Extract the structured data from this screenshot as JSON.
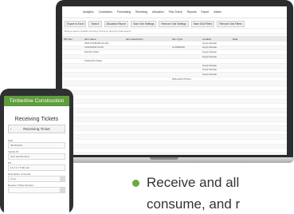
{
  "desktop": {
    "nav": [
      "Analytics",
      "Contractors",
      "Purchasing",
      "Receiving",
      "Allocation",
      "Pick Check",
      "Reports",
      "Export",
      "Admin"
    ],
    "toolbar": [
      "Export to Excel",
      "Search",
      "Allocation Report",
      "Save Grid Settings",
      "Remove Grid Settings",
      "Save Grid Filters",
      "Remove Grid Filters"
    ],
    "group_hint": "Drag a column header and drop it here to group by that column",
    "columns": [
      "Mfr Item",
      "Item Name",
      "Item Description",
      "Item Type",
      "Location",
      "Date"
    ],
    "rows": [
      [
        "",
        "SEMI-STANDARD IN-LINE",
        "",
        "",
        "Supply Mandate",
        ""
      ],
      [
        "",
        "ULTRASONIC FLOW",
        "",
        "FLOWMETER",
        "Supply Mandate",
        ""
      ],
      [
        "",
        "MOTOR START",
        "",
        "",
        "Supply Mandate",
        ""
      ],
      [
        "",
        "",
        "",
        "",
        "Supply Mandate",
        ""
      ],
      [
        "",
        "STAINLESS STEEL",
        "",
        "",
        "",
        ""
      ],
      [
        "",
        "",
        "",
        "",
        "Supply Mandate",
        ""
      ],
      [
        "",
        "",
        "",
        "",
        "Supply Mandate",
        ""
      ],
      [
        "",
        "",
        "",
        "",
        "Supply Mandate",
        ""
      ],
      [
        "",
        "",
        "",
        "PIPE AND FITTINGS",
        "",
        ""
      ],
      [
        "",
        "",
        "",
        "",
        "",
        ""
      ],
      [
        "",
        "",
        "",
        "",
        "",
        ""
      ],
      [
        "",
        "",
        "",
        "",
        "",
        ""
      ],
      [
        "",
        "",
        "",
        "",
        "",
        ""
      ],
      [
        "",
        "",
        "",
        "",
        "",
        ""
      ],
      [
        "",
        "",
        "",
        "",
        "",
        ""
      ],
      [
        "",
        "",
        "",
        "",
        "",
        ""
      ],
      [
        "",
        "",
        "",
        "",
        "",
        ""
      ],
      [
        "",
        "",
        "",
        "",
        "",
        ""
      ],
      [
        "",
        "",
        "",
        "",
        "",
        ""
      ],
      [
        "",
        "",
        "",
        "",
        "",
        ""
      ],
      [
        "",
        "",
        "",
        "",
        "",
        ""
      ],
      [
        "",
        "",
        "",
        "",
        "",
        ""
      ],
      [
        "",
        "",
        "",
        "",
        "",
        ""
      ],
      [
        "",
        "",
        "",
        "",
        "",
        ""
      ],
      [
        "",
        "",
        "",
        "",
        "",
        ""
      ],
      [
        "",
        "",
        "",
        "",
        "",
        ""
      ],
      [
        "",
        "",
        "",
        "",
        "",
        ""
      ],
      [
        "",
        "",
        "",
        "",
        "",
        ""
      ]
    ]
  },
  "mobile": {
    "app_title": "Timberline Construction",
    "page_title": "Receiving Tickets",
    "sub_title": "Receiving Ticket",
    "fields": [
      {
        "label": "Date",
        "value": "05/15/2019"
      },
      {
        "label": "Vendor ID",
        "value": "USA Gas Bonded"
      },
      {
        "label": "PO",
        "value": "14.4.1-7 THD Lab"
      },
      {
        "label": "Description of Goods",
        "value": "Conc."
      },
      {
        "label": "Receiver Ticket Number",
        "value": ""
      }
    ]
  },
  "bullet": {
    "line1": "Receive and all",
    "line2": "consume, and r"
  },
  "colors": {
    "brand_green": "#5f9d3c",
    "bullet_green": "#6aaa47",
    "device_dark": "#2a2c2e"
  }
}
